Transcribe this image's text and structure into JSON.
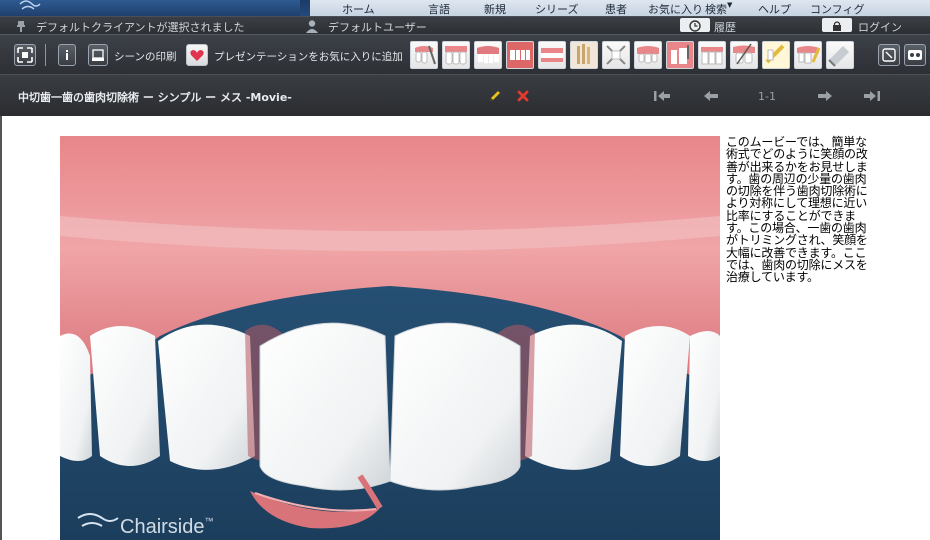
{
  "app": {
    "nav": [
      "ホーム",
      "言語",
      "新規",
      "シリーズ",
      "患者",
      "お気に入り",
      "検索",
      "ヘルプ",
      "コンフィグ"
    ]
  },
  "status": {
    "client": "デフォルトクライアントが選択されました",
    "user": "デフォルトユーザー",
    "history": "履歴",
    "login": "ログイン"
  },
  "toolbar": {
    "print_scene": "シーンの印刷",
    "add_favorite": "プレゼンテーションをお気に入りに追加"
  },
  "title": {
    "text": "中切歯一歯の歯肉切除術 ー シンプル ー メス -Movie-",
    "page": "1-1"
  },
  "video": {
    "watermark": "Chairside",
    "tm": "™"
  },
  "description": "このムービーでは、簡単な術式でどのように笑顔の改善が出来るかをお見せします。歯の周辺の少量の歯肉の切除を伴う歯肉切除術により対称にして理想に近い比率にすることができます。この場合、一歯の歯肉がトリミングされ、笑顔を大幅に改善できます。ここでは、歯肉の切除にメスを治療しています。",
  "colors": {
    "accent": "#e8c21a",
    "delete": "#e23b2e",
    "heart": "#e0334f",
    "video_bg": "#1f4a6c",
    "gum": "#e8868a"
  }
}
